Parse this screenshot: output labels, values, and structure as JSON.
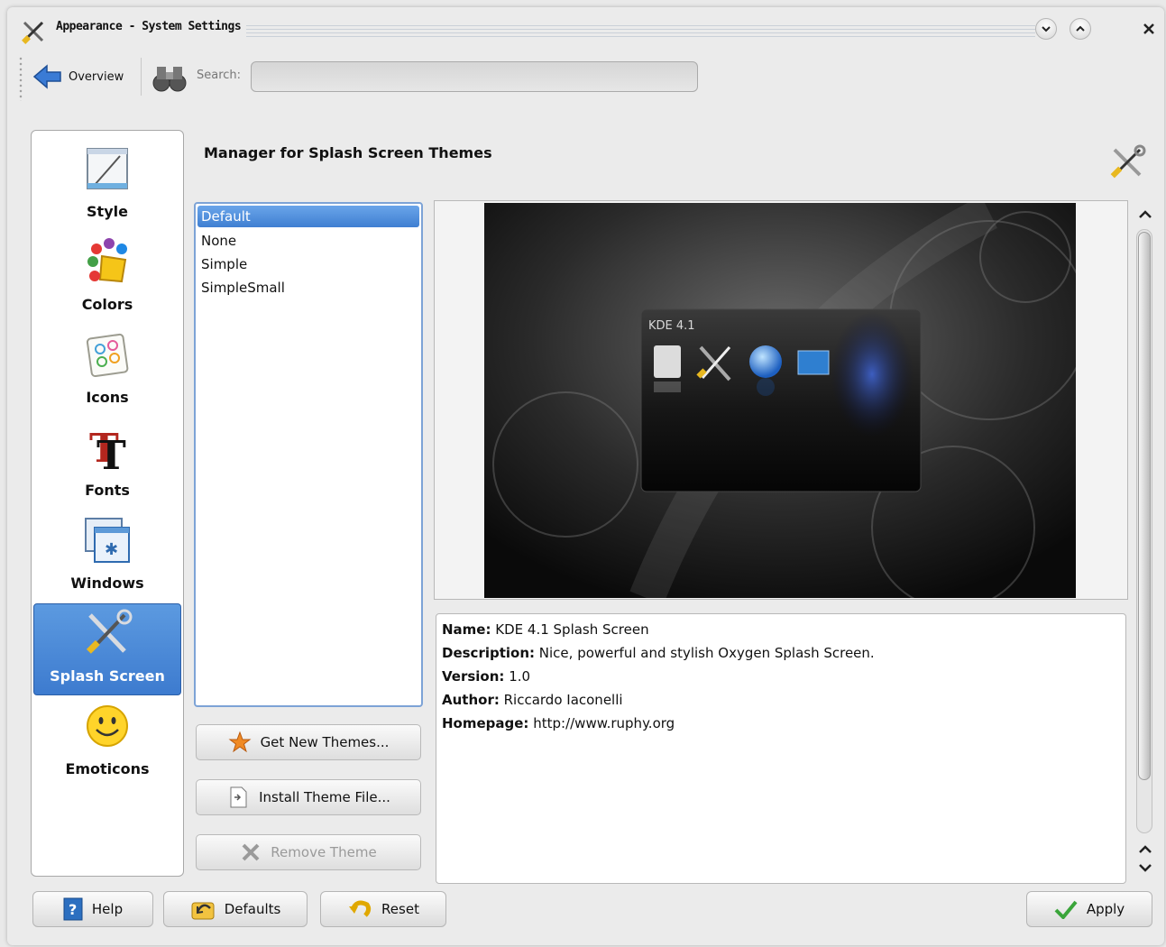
{
  "window": {
    "title": "Appearance - System Settings"
  },
  "toolbar": {
    "overview_label": "Overview",
    "search_label": "Search:",
    "search_value": ""
  },
  "sidebar": {
    "items": [
      {
        "label": "Style",
        "icon": "style-icon"
      },
      {
        "label": "Colors",
        "icon": "colors-icon"
      },
      {
        "label": "Icons",
        "icon": "icons-icon"
      },
      {
        "label": "Fonts",
        "icon": "fonts-icon"
      },
      {
        "label": "Windows",
        "icon": "windows-icon"
      },
      {
        "label": "Splash Screen",
        "icon": "splash-screen-icon",
        "selected": true
      },
      {
        "label": "Emoticons",
        "icon": "emoticons-icon"
      }
    ]
  },
  "main": {
    "title": "Manager for Splash Screen Themes",
    "themes": [
      "Default",
      "None",
      "Simple",
      "SimpleSmall"
    ],
    "selected_theme": "Default",
    "buttons": {
      "get_new": "Get New Themes...",
      "install": "Install Theme File...",
      "remove": "Remove Theme"
    },
    "preview": {
      "splash_label": "KDE 4.1"
    },
    "info": {
      "name_label": "Name:",
      "name_value": "KDE 4.1 Splash Screen",
      "description_label": "Description:",
      "description_value": "Nice, powerful and stylish Oxygen Splash Screen.",
      "version_label": "Version:",
      "version_value": "1.0",
      "author_label": "Author:",
      "author_value": "Riccardo Iaconelli",
      "homepage_label": "Homepage:",
      "homepage_value": "http://www.ruphy.org"
    }
  },
  "footer": {
    "help": "Help",
    "defaults": "Defaults",
    "reset": "Reset",
    "apply": "Apply"
  },
  "colors": {
    "selection": "#3f7fd2",
    "apply_check": "#3aa53a"
  }
}
